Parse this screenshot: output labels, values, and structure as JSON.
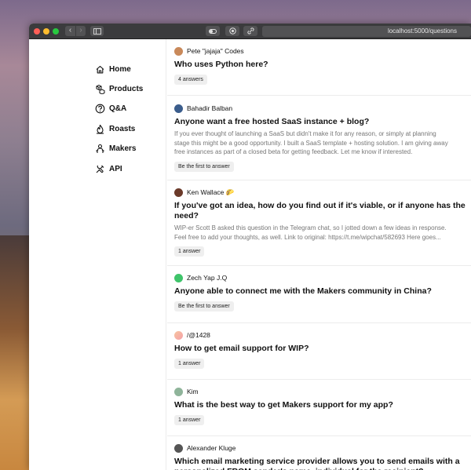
{
  "browser": {
    "url": "localhost:5000/questions"
  },
  "nav": {
    "items": [
      {
        "label": "Home",
        "icon": "home-icon"
      },
      {
        "label": "Products",
        "icon": "products-icon"
      },
      {
        "label": "Q&A",
        "icon": "question-icon"
      },
      {
        "label": "Roasts",
        "icon": "roast-icon"
      },
      {
        "label": "Makers",
        "icon": "makers-icon"
      },
      {
        "label": "API",
        "icon": "api-icon"
      }
    ]
  },
  "questions": [
    {
      "author": "Pete \"jajaja\" Codes",
      "avatar_color": "#c9895a",
      "title": "Who uses Python here?",
      "excerpt": "",
      "badge": "4 answers"
    },
    {
      "author": "Bahadir Balban",
      "avatar_color": "#3b5d8c",
      "title": "Anyone want a free hosted SaaS instance + blog?",
      "excerpt": [
        "If you ever thought of launching a SaaS but didn't make it for any reason, or simply at planning",
        "stage this might be a good opportunity. I built a SaaS template + hosting solution. I am giving away",
        "free instances as part of a closed beta for getting feedback. Let me know if interested."
      ],
      "badge": "Be the first to answer"
    },
    {
      "author": "Ken Wallace 🌮",
      "avatar_color": "#6b3a2a",
      "title": "If you've got an idea, how do you find out if it's viable, or if anyone has the need?",
      "excerpt": [
        "WIP-er Scott B asked this question in the Telegram chat, so I jotted down a few ideas in response.",
        "Feel free to add your thoughts, as well. Link to original: https://t.me/wipchat/582693 Here goes..."
      ],
      "badge": "1 answer"
    },
    {
      "author": "Zech Yap J.Q",
      "avatar_color": "#3fc46a",
      "title": "Anyone able to connect me with the Makers community in China?",
      "excerpt": "",
      "badge": "Be the first to answer"
    },
    {
      "author": "/@1428",
      "avatar_color": "#f5a0a8",
      "title": "How to get email support for WIP?",
      "excerpt": "",
      "badge": "1 answer"
    },
    {
      "author": "Kim",
      "avatar_color": "#8fb49a",
      "title": "What is the best way to get Makers support for my app?",
      "excerpt": "",
      "badge": "1 answer"
    },
    {
      "author": "Alexander Kluge",
      "avatar_color": "#555555",
      "title": "Which email marketing service provider allows you to send emails with a personalized FROM sender's name, individual for the recipient?",
      "excerpt": "",
      "badge": ""
    }
  ]
}
